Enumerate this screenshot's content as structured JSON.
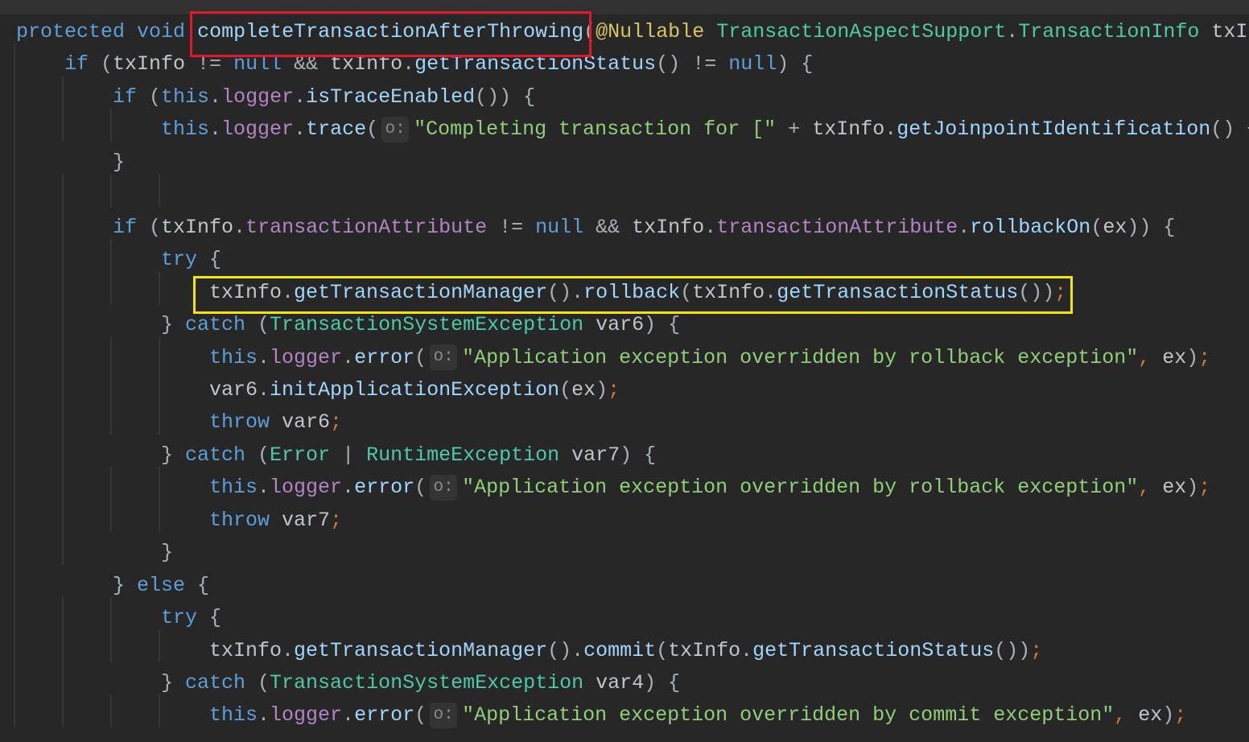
{
  "colors": {
    "keyword": "#5c9fd9",
    "method": "#9fd6fb",
    "field": "#b384c4",
    "type": "#4ec9a8",
    "string": "#8fcf78",
    "annotation": "#d8c465",
    "semicolon": "#d0792f",
    "background": "#272727",
    "highlight_red": "#e0182a",
    "highlight_yellow": "#f4e600"
  },
  "code_lines": [
    {
      "indent": 0,
      "tokens": [
        [
          "k",
          "protected"
        ],
        [
          "p",
          " "
        ],
        [
          "k",
          "void"
        ],
        [
          "p",
          " "
        ],
        [
          "m",
          "completeTransactionAfterThrowing"
        ],
        [
          "o",
          "("
        ],
        [
          "a",
          "@Nullable"
        ],
        [
          "p",
          " "
        ],
        [
          "t",
          "TransactionAspectSupport"
        ],
        [
          "o",
          "."
        ],
        [
          "t",
          "TransactionInfo"
        ],
        [
          "p",
          " txI"
        ]
      ]
    },
    {
      "indent": 1,
      "tokens": [
        [
          "k",
          "if"
        ],
        [
          "o",
          " ("
        ],
        [
          "p",
          "txInfo"
        ],
        [
          "o",
          " != "
        ],
        [
          "k",
          "null"
        ],
        [
          "o",
          " && "
        ],
        [
          "p",
          "txInfo"
        ],
        [
          "o",
          "."
        ],
        [
          "m",
          "getTransactionStatus"
        ],
        [
          "o",
          "() != "
        ],
        [
          "k",
          "null"
        ],
        [
          "o",
          ") {"
        ]
      ]
    },
    {
      "indent": 2,
      "tokens": [
        [
          "k",
          "if"
        ],
        [
          "o",
          " ("
        ],
        [
          "k",
          "this"
        ],
        [
          "o",
          "."
        ],
        [
          "f",
          "logger"
        ],
        [
          "o",
          "."
        ],
        [
          "m",
          "isTraceEnabled"
        ],
        [
          "o",
          "()) {"
        ]
      ]
    },
    {
      "indent": 3,
      "tokens": [
        [
          "k",
          "this"
        ],
        [
          "o",
          "."
        ],
        [
          "f",
          "logger"
        ],
        [
          "o",
          "."
        ],
        [
          "m",
          "trace"
        ],
        [
          "o",
          "("
        ],
        [
          "h",
          "o:"
        ],
        [
          "s",
          "\"Completing transaction for [\""
        ],
        [
          "o",
          " + "
        ],
        [
          "p",
          "txInfo"
        ],
        [
          "o",
          "."
        ],
        [
          "m",
          "getJoinpointIdentification"
        ],
        [
          "o",
          "() +"
        ]
      ]
    },
    {
      "indent": 2,
      "tokens": [
        [
          "o",
          "}"
        ]
      ]
    },
    {
      "indent": 0,
      "tokens": []
    },
    {
      "indent": 2,
      "tokens": [
        [
          "k",
          "if"
        ],
        [
          "o",
          " ("
        ],
        [
          "p",
          "txInfo"
        ],
        [
          "o",
          "."
        ],
        [
          "f",
          "transactionAttribute"
        ],
        [
          "o",
          " != "
        ],
        [
          "k",
          "null"
        ],
        [
          "o",
          " && "
        ],
        [
          "p",
          "txInfo"
        ],
        [
          "o",
          "."
        ],
        [
          "f",
          "transactionAttribute"
        ],
        [
          "o",
          "."
        ],
        [
          "m",
          "rollbackOn"
        ],
        [
          "o",
          "("
        ],
        [
          "p",
          "ex"
        ],
        [
          "o",
          ")) {"
        ]
      ]
    },
    {
      "indent": 3,
      "tokens": [
        [
          "k",
          "try"
        ],
        [
          "o",
          " {"
        ]
      ]
    },
    {
      "indent": 4,
      "tokens": [
        [
          "p",
          "txInfo"
        ],
        [
          "o",
          "."
        ],
        [
          "m",
          "getTransactionManager"
        ],
        [
          "o",
          "()."
        ],
        [
          "m",
          "rollback"
        ],
        [
          "o",
          "("
        ],
        [
          "p",
          "txInfo"
        ],
        [
          "o",
          "."
        ],
        [
          "m",
          "getTransactionStatus"
        ],
        [
          "o",
          "())"
        ],
        [
          "semi",
          ";"
        ]
      ]
    },
    {
      "indent": 3,
      "tokens": [
        [
          "o",
          "} "
        ],
        [
          "k",
          "catch"
        ],
        [
          "o",
          " ("
        ],
        [
          "t",
          "TransactionSystemException"
        ],
        [
          "p",
          " var6"
        ],
        [
          "o",
          ") {"
        ]
      ]
    },
    {
      "indent": 4,
      "tokens": [
        [
          "k",
          "this"
        ],
        [
          "o",
          "."
        ],
        [
          "f",
          "logger"
        ],
        [
          "o",
          "."
        ],
        [
          "m",
          "error"
        ],
        [
          "o",
          "("
        ],
        [
          "h",
          "o:"
        ],
        [
          "s",
          "\"Application exception overridden by rollback exception\""
        ],
        [
          "semi",
          ","
        ],
        [
          "p",
          " ex"
        ],
        [
          "o",
          ")"
        ],
        [
          "semi",
          ";"
        ]
      ]
    },
    {
      "indent": 4,
      "tokens": [
        [
          "p",
          "var6"
        ],
        [
          "o",
          "."
        ],
        [
          "m",
          "initApplicationException"
        ],
        [
          "o",
          "("
        ],
        [
          "p",
          "ex"
        ],
        [
          "o",
          ")"
        ],
        [
          "semi",
          ";"
        ]
      ]
    },
    {
      "indent": 4,
      "tokens": [
        [
          "k",
          "throw"
        ],
        [
          "p",
          " var6"
        ],
        [
          "semi",
          ";"
        ]
      ]
    },
    {
      "indent": 3,
      "tokens": [
        [
          "o",
          "} "
        ],
        [
          "k",
          "catch"
        ],
        [
          "o",
          " ("
        ],
        [
          "t",
          "Error"
        ],
        [
          "o",
          " | "
        ],
        [
          "t",
          "RuntimeException"
        ],
        [
          "p",
          " var7"
        ],
        [
          "o",
          ") {"
        ]
      ]
    },
    {
      "indent": 4,
      "tokens": [
        [
          "k",
          "this"
        ],
        [
          "o",
          "."
        ],
        [
          "f",
          "logger"
        ],
        [
          "o",
          "."
        ],
        [
          "m",
          "error"
        ],
        [
          "o",
          "("
        ],
        [
          "h",
          "o:"
        ],
        [
          "s",
          "\"Application exception overridden by rollback exception\""
        ],
        [
          "semi",
          ","
        ],
        [
          "p",
          " ex"
        ],
        [
          "o",
          ")"
        ],
        [
          "semi",
          ";"
        ]
      ]
    },
    {
      "indent": 4,
      "tokens": [
        [
          "k",
          "throw"
        ],
        [
          "p",
          " var7"
        ],
        [
          "semi",
          ";"
        ]
      ]
    },
    {
      "indent": 3,
      "tokens": [
        [
          "o",
          "}"
        ]
      ]
    },
    {
      "indent": 2,
      "tokens": [
        [
          "o",
          "} "
        ],
        [
          "k",
          "else"
        ],
        [
          "o",
          " {"
        ]
      ]
    },
    {
      "indent": 3,
      "tokens": [
        [
          "k",
          "try"
        ],
        [
          "o",
          " {"
        ]
      ]
    },
    {
      "indent": 4,
      "tokens": [
        [
          "p",
          "txInfo"
        ],
        [
          "o",
          "."
        ],
        [
          "m",
          "getTransactionManager"
        ],
        [
          "o",
          "()."
        ],
        [
          "m",
          "commit"
        ],
        [
          "o",
          "("
        ],
        [
          "p",
          "txInfo"
        ],
        [
          "o",
          "."
        ],
        [
          "m",
          "getTransactionStatus"
        ],
        [
          "o",
          "())"
        ],
        [
          "semi",
          ";"
        ]
      ]
    },
    {
      "indent": 3,
      "tokens": [
        [
          "o",
          "} "
        ],
        [
          "k",
          "catch"
        ],
        [
          "o",
          " ("
        ],
        [
          "t",
          "TransactionSystemException"
        ],
        [
          "p",
          " var4"
        ],
        [
          "o",
          ") {"
        ]
      ]
    },
    {
      "indent": 4,
      "tokens": [
        [
          "k",
          "this"
        ],
        [
          "o",
          "."
        ],
        [
          "f",
          "logger"
        ],
        [
          "o",
          "."
        ],
        [
          "m",
          "error"
        ],
        [
          "o",
          "("
        ],
        [
          "h",
          "o:"
        ],
        [
          "s",
          "\"Application exception overridden by commit exception\""
        ],
        [
          "semi",
          ","
        ],
        [
          "p",
          " ex"
        ],
        [
          "o",
          ")"
        ],
        [
          "semi",
          ";"
        ]
      ]
    }
  ]
}
